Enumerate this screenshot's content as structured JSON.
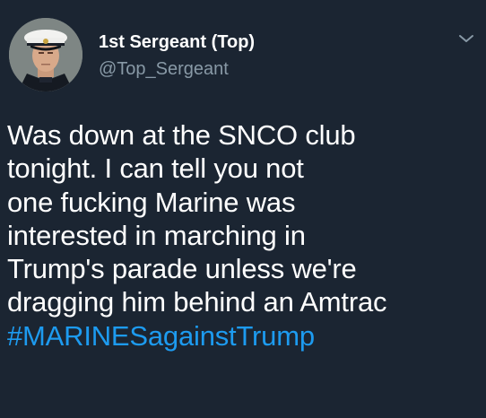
{
  "author": {
    "display_name": "1st Sergeant (Top)",
    "handle": "@Top_Sergeant"
  },
  "tweet": {
    "lines": [
      "Was down at the SNCO club",
      "tonight. I can tell you not",
      "one fucking Marine was",
      "interested in marching in",
      "Trump's parade unless we're",
      "dragging him behind an Amtrac"
    ],
    "hashtag": "#MARINESagainstTrump"
  },
  "icons": {
    "menu": "chevron-down-icon",
    "avatar": "marine-dress-blues-portrait"
  },
  "colors": {
    "background": "#1b2532",
    "text": "#ffffff",
    "secondary": "#8899a6",
    "link": "#1d9bf0"
  }
}
